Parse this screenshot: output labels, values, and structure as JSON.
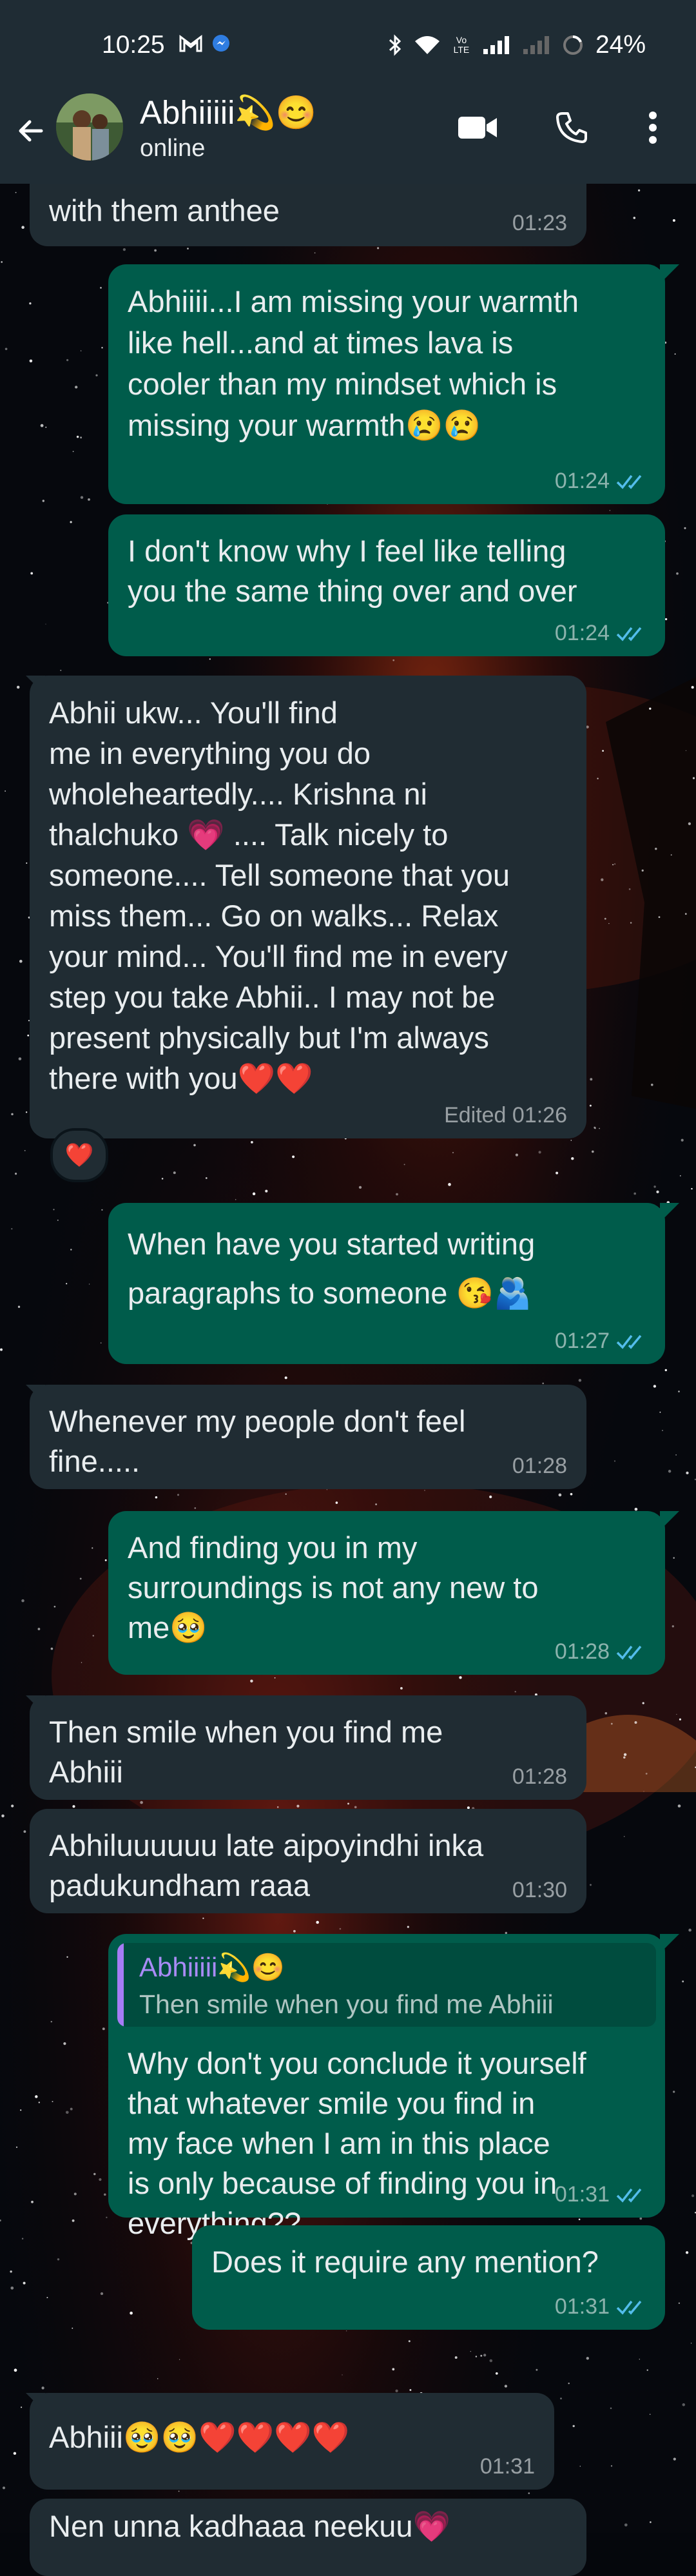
{
  "status_bar": {
    "time": "10:25",
    "network": "Vo LTE",
    "battery": "24%"
  },
  "header": {
    "contact_name": "Abhiiiii💫😊",
    "status": "online",
    "icons": [
      "back-arrow-icon",
      "video-call-icon",
      "phone-icon",
      "more-vertical-icon"
    ]
  },
  "colors": {
    "bar": "#1f2c34",
    "incoming_bubble": "#202c33",
    "outgoing_bubble": "#005c4b",
    "read_ticks": "#53bdeb",
    "quote_accent": "#a67cf5"
  },
  "messages": [
    {
      "direction": "in",
      "text": "with them anthee",
      "partial_above": "…",
      "time": "01:23"
    },
    {
      "direction": "out",
      "text": "Abhiiii...I am missing your warmth\nlike hell...and at times lava is\ncooler than my mindset which is\nmissing your warmth😢😢",
      "time": "01:24",
      "ticks": "read"
    },
    {
      "direction": "out",
      "text": "I don't know why I feel like telling\nyou the same thing over and over",
      "time": "01:24",
      "ticks": "read"
    },
    {
      "direction": "in",
      "text": "Abhii ukw... You'll find\nme in everything you do\nwholeheartedly.... Krishna ni\nthalchuko 💗 .... Talk nicely to\nsomeone.... Tell someone that you\nmiss them... Go on walks... Relax\nyour mind... You'll find me in every\nstep you take Abhii.. I may not be\npresent physically but I'm always\nthere with you❤️❤️",
      "time": "Edited 01:26",
      "reaction": "❤️"
    },
    {
      "direction": "out",
      "text": "When have you started writing\nparagraphs to someone 😘🫂",
      "time": "01:27",
      "ticks": "read"
    },
    {
      "direction": "in",
      "text": "Whenever my people don't feel\nfine.....",
      "time": "01:28"
    },
    {
      "direction": "out",
      "text": "And finding you in my\nsurroundings is not any new to\nme🥹",
      "time": "01:28",
      "ticks": "read"
    },
    {
      "direction": "in",
      "text": "Then smile when you find me\nAbhiii",
      "time": "01:28"
    },
    {
      "direction": "in",
      "text": "Abhiluuuuuu late aipoyindhi inka\npadukundham raaa",
      "time": "01:30"
    },
    {
      "direction": "out",
      "quote": {
        "name": "Abhiiiii💫😊",
        "text": "Then smile when you find me Abhiii"
      },
      "text": "Why don't you conclude it yourself\nthat whatever smile you find in\nmy face when I am in this place\nis only because of finding you in\neverything??",
      "time": "01:31",
      "ticks": "read"
    },
    {
      "direction": "out",
      "text": "Does it require any mention?",
      "time": "01:31",
      "ticks": "read"
    },
    {
      "direction": "in",
      "text": "Abhiii🥹🥹❤️❤️❤️❤️",
      "time": "01:31"
    },
    {
      "direction": "in",
      "text": "Nen unna kadhaaa neekuu💗"
    }
  ]
}
